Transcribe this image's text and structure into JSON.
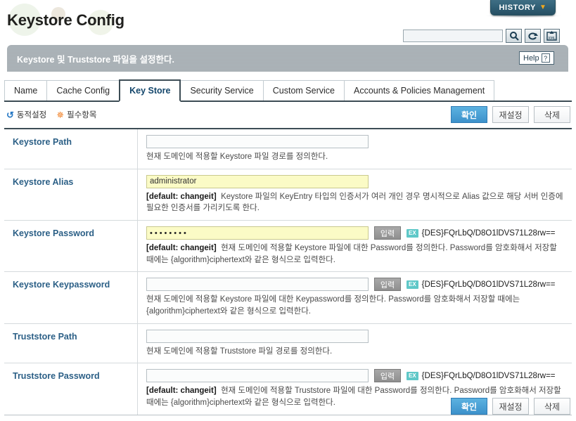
{
  "header": {
    "history_label": "HISTORY",
    "history_caret": "chevron-down-icon",
    "page_title": "Keystore Config",
    "description": "Keystore 및 Truststore 파일을 설정한다.",
    "help_label": "Help",
    "help_mark": "?"
  },
  "search": {
    "value": "",
    "placeholder": "",
    "buttons": [
      "search-icon",
      "refresh-icon",
      "xml-export-icon"
    ]
  },
  "tabs": [
    {
      "label": "Name",
      "active": false
    },
    {
      "label": "Cache Config",
      "active": false
    },
    {
      "label": "Key Store",
      "active": true
    },
    {
      "label": "Security Service",
      "active": false
    },
    {
      "label": "Custom Service",
      "active": false
    },
    {
      "label": "Accounts & Policies Management",
      "active": false
    }
  ],
  "legend": {
    "dynamic_label": "동적설정",
    "required_label": "필수항목",
    "dynamic_icon": "refresh-icon",
    "required_icon": "asterisk-icon"
  },
  "actions": {
    "confirm": "확인",
    "reset": "재설정",
    "delete": "삭제"
  },
  "fields": [
    {
      "label": "Keystore Path",
      "value": "",
      "masked": false,
      "highlight": false,
      "has_input_button": false,
      "input_button_label": "",
      "cipher": "",
      "cipher_badge": "",
      "hint_default": "",
      "hint": "현재 도메인에 적용할 Keystore 파일 경로를 정의한다."
    },
    {
      "label": "Keystore Alias",
      "value": "administrator",
      "masked": false,
      "highlight": true,
      "has_input_button": false,
      "input_button_label": "",
      "cipher": "",
      "cipher_badge": "",
      "hint_default": "[default: changeit]",
      "hint": "Keystore 파일의 KeyEntry 타입의 인증서가 여러 개인 경우 명시적으로 Alias 값으로 해당 서버 인증에 필요한 인증서를 가리키도록 한다."
    },
    {
      "label": "Keystore Password",
      "value": "••••••••",
      "masked": true,
      "highlight": true,
      "has_input_button": true,
      "input_button_label": "입력",
      "cipher": "{DES}FQrLbQ/D8O1lDVS71L28rw==",
      "cipher_badge": "EX",
      "hint_default": "[default: changeit]",
      "hint": "현재 도메인에 적용할 Keystore 파일에 대한 Password를 정의한다. Password를 암호화해서 저장할 때에는 {algorithm}ciphertext와 같은 형식으로 입력한다."
    },
    {
      "label": "Keystore Keypassword",
      "value": "",
      "masked": false,
      "highlight": false,
      "has_input_button": true,
      "input_button_label": "입력",
      "cipher": "{DES}FQrLbQ/D8O1lDVS71L28rw==",
      "cipher_badge": "EX",
      "hint_default": "",
      "hint": "현재 도메인에 적용할 Keystore 파일에 대한 Keypassword를 정의한다. Password를 암호화해서 저장할 때에는 {algorithm}ciphertext와 같은 형식으로 입력한다."
    },
    {
      "label": "Truststore Path",
      "value": "",
      "masked": false,
      "highlight": false,
      "has_input_button": false,
      "input_button_label": "",
      "cipher": "",
      "cipher_badge": "",
      "hint_default": "",
      "hint": "현재 도메인에 적용할 Truststore 파일 경로를 정의한다."
    },
    {
      "label": "Truststore Password",
      "value": "",
      "masked": false,
      "highlight": false,
      "has_input_button": true,
      "input_button_label": "입력",
      "cipher": "{DES}FQrLbQ/D8O1lDVS71L28rw==",
      "cipher_badge": "EX",
      "hint_default": "[default: changeit]",
      "hint": "현재 도메인에 적용할 Truststore 파일에 대한 Password를 정의한다. Password를 암호화해서 저장할 때에는 {algorithm}ciphertext와 같은 형식으로 입력한다."
    }
  ],
  "colors": {
    "accent": "#2b5f86",
    "primary_button": "#3c91cb",
    "highlight_field": "#fbfbc6",
    "desc_bar": "#a8b0b5",
    "history_tab": "#2f5d73",
    "ex_badge": "#5fc8c8"
  }
}
